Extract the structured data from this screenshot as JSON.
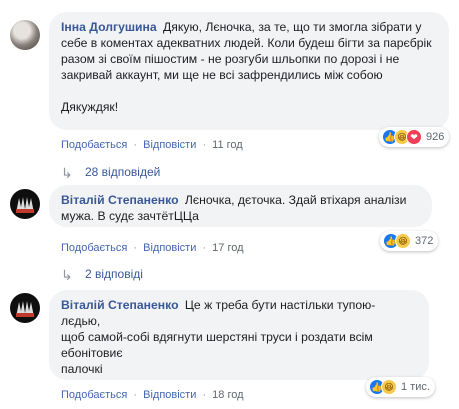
{
  "comments": [
    {
      "author": "Інна Долгушина",
      "text": "Дякую, Лєночка, за те, що ти змогла зібрати у себе в коментах адекватних людей. Коли будеш бігти за парєбрік разом зі своїм пішостим - не розгуби шльопки по дорозі і не закривай аккаунт, ми ще не всі зафрендились між собою\n\nДякуждяк!",
      "reaction_count": "926",
      "like": "Подобається",
      "reply": "Відповісти",
      "time": "11 год",
      "replies": "28 відповідей"
    },
    {
      "author": "Віталій Степаненко",
      "text": "Лєночка, дєточка. Здай втіхаря аналізи мужа. В судє зачтётЦЦа",
      "reaction_count": "372",
      "like": "Подобається",
      "reply": "Відповісти",
      "time": "17 год",
      "replies": "2 відповіді"
    },
    {
      "author": "Віталій Степаненко",
      "text": "Це ж треба бути настільки тупою-\nлєдью,\nщоб самой-собі вдягнути шерстяні труси і роздати всім ебонітовиє\nпалочкі",
      "reaction_count": "1 тис.",
      "like": "Подобається",
      "reply": "Відповісти",
      "time": "18 год"
    }
  ],
  "separator": "·",
  "icons": [
    "like-icon",
    "haha-icon",
    "love-icon",
    "reply-arrow-icon"
  ],
  "colors": {
    "author": "#385898",
    "bubble": "#f2f3f5",
    "like": "#1877f2",
    "love": "#f33e58",
    "haha": "#f7c948"
  }
}
